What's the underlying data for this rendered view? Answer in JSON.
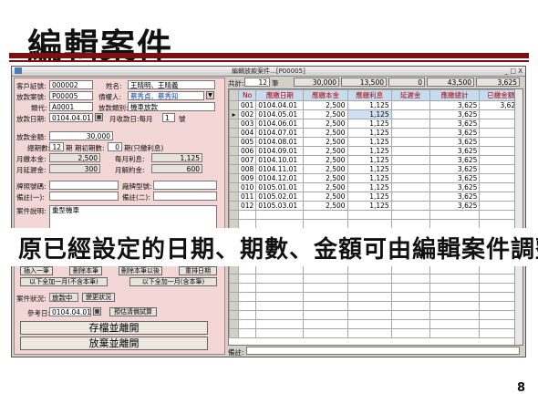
{
  "slide": {
    "title": "編輯案件",
    "overlay_text": "原已經設定的日期、期數、金額可由編輯案件調整",
    "page_number": "8"
  },
  "window": {
    "title": "編輯放款案件...[P00005]",
    "controls": "_ □ X"
  },
  "form": {
    "customer_id_label": "客戶証號:",
    "customer_id": "000002",
    "name_label": "姓名:",
    "name": "王晴明、王晴義",
    "loan_case_label": "放款案號:",
    "loan_case": "P00005",
    "creditor_label": "債權人:",
    "creditor": "蔡秀貞、蔡秀知",
    "type_label": "類代:",
    "type_code": "A0001",
    "loan_category_label": "放款類別:",
    "loan_category": "機車放款",
    "loan_date_label": "放款日期:",
    "loan_date": "0104.04.01",
    "monthly_day_label": "月收款日:每月",
    "monthly_day": "1",
    "monthly_day_suffix": "號",
    "loan_amount_label": "放款金額:",
    "loan_amount": "30,000",
    "periods_label": "總期數:",
    "periods": "12",
    "periods_unit": "期",
    "prepaid_label": "期初期數:",
    "prepaid": "0",
    "prepaid_note": "期(只繳利息)",
    "monthly_principal_label": "月繳本金:",
    "monthly_principal": "2,500",
    "monthly_interest_label": "每月利息:",
    "monthly_interest": "1,125",
    "late_fee_label": "月延遲金:",
    "late_fee": "300",
    "breach_label": "月解約金:",
    "breach": "600",
    "plate_label": "牌照號碼:",
    "vehicle_label": "廠牌型號:",
    "note1_label": "備註(一):",
    "note2_label": "備註(二):",
    "desc_label": "案件說明:",
    "desc": "重型機車",
    "insert_btn": "插入一筆",
    "delete_btn": "刪除本筆",
    "delete_after_btn": "刪除本筆以後",
    "reorder_btn": "重排日期",
    "add_month_excl_btn": "以下全加一月(不含本筆)",
    "add_month_incl_btn": "以下全加一月(含本筆)",
    "status_label": "案件狀況:",
    "status": "放款中",
    "change_status_btn": "變更狀況",
    "ref_date_label": "參考日:",
    "ref_date": "0104.04.01",
    "preview_btn": "預估清償試算",
    "save_btn": "存檔並離開",
    "discard_btn": "放棄並離開"
  },
  "summary": {
    "total_label": "共計:",
    "count": "12",
    "count_unit": "筆",
    "principal_total": "30,000",
    "interest_total": "13,500",
    "late_total": "0",
    "grand_total": "43,500",
    "paid_total": "3,625"
  },
  "table": {
    "headers": [
      "No",
      "應繳日期",
      "應繳本金",
      "應繳利息",
      "延遲金",
      "應繳總計",
      "已繳金額"
    ],
    "rows": [
      [
        "001",
        "0104.04.01",
        "2,500",
        "1,125",
        "",
        "3,625",
        "3,625"
      ],
      [
        "002",
        "0104.05.01",
        "2,500",
        "1,125",
        "",
        "3,625",
        ""
      ],
      [
        "003",
        "0104.06.01",
        "2,500",
        "1,125",
        "",
        "3,625",
        ""
      ],
      [
        "004",
        "0104.07.01",
        "2,500",
        "1,125",
        "",
        "3,625",
        ""
      ],
      [
        "005",
        "0104.08.01",
        "2,500",
        "1,125",
        "",
        "3,625",
        ""
      ],
      [
        "006",
        "0104.09.01",
        "2,500",
        "1,125",
        "",
        "3,625",
        ""
      ],
      [
        "007",
        "0104.10.01",
        "2,500",
        "1,125",
        "",
        "3,625",
        ""
      ],
      [
        "008",
        "0104.11.01",
        "2,500",
        "1,125",
        "",
        "3,625",
        ""
      ],
      [
        "009",
        "0104.12.01",
        "2,500",
        "1,125",
        "",
        "3,625",
        ""
      ],
      [
        "010",
        "0105.01.01",
        "2,500",
        "1,125",
        "",
        "3,625",
        ""
      ],
      [
        "011",
        "0105.02.01",
        "2,500",
        "1,125",
        "",
        "3,625",
        ""
      ],
      [
        "012",
        "0105.03.01",
        "2,500",
        "1,125",
        "",
        "3,625",
        ""
      ]
    ],
    "note_label": "備註:"
  }
}
